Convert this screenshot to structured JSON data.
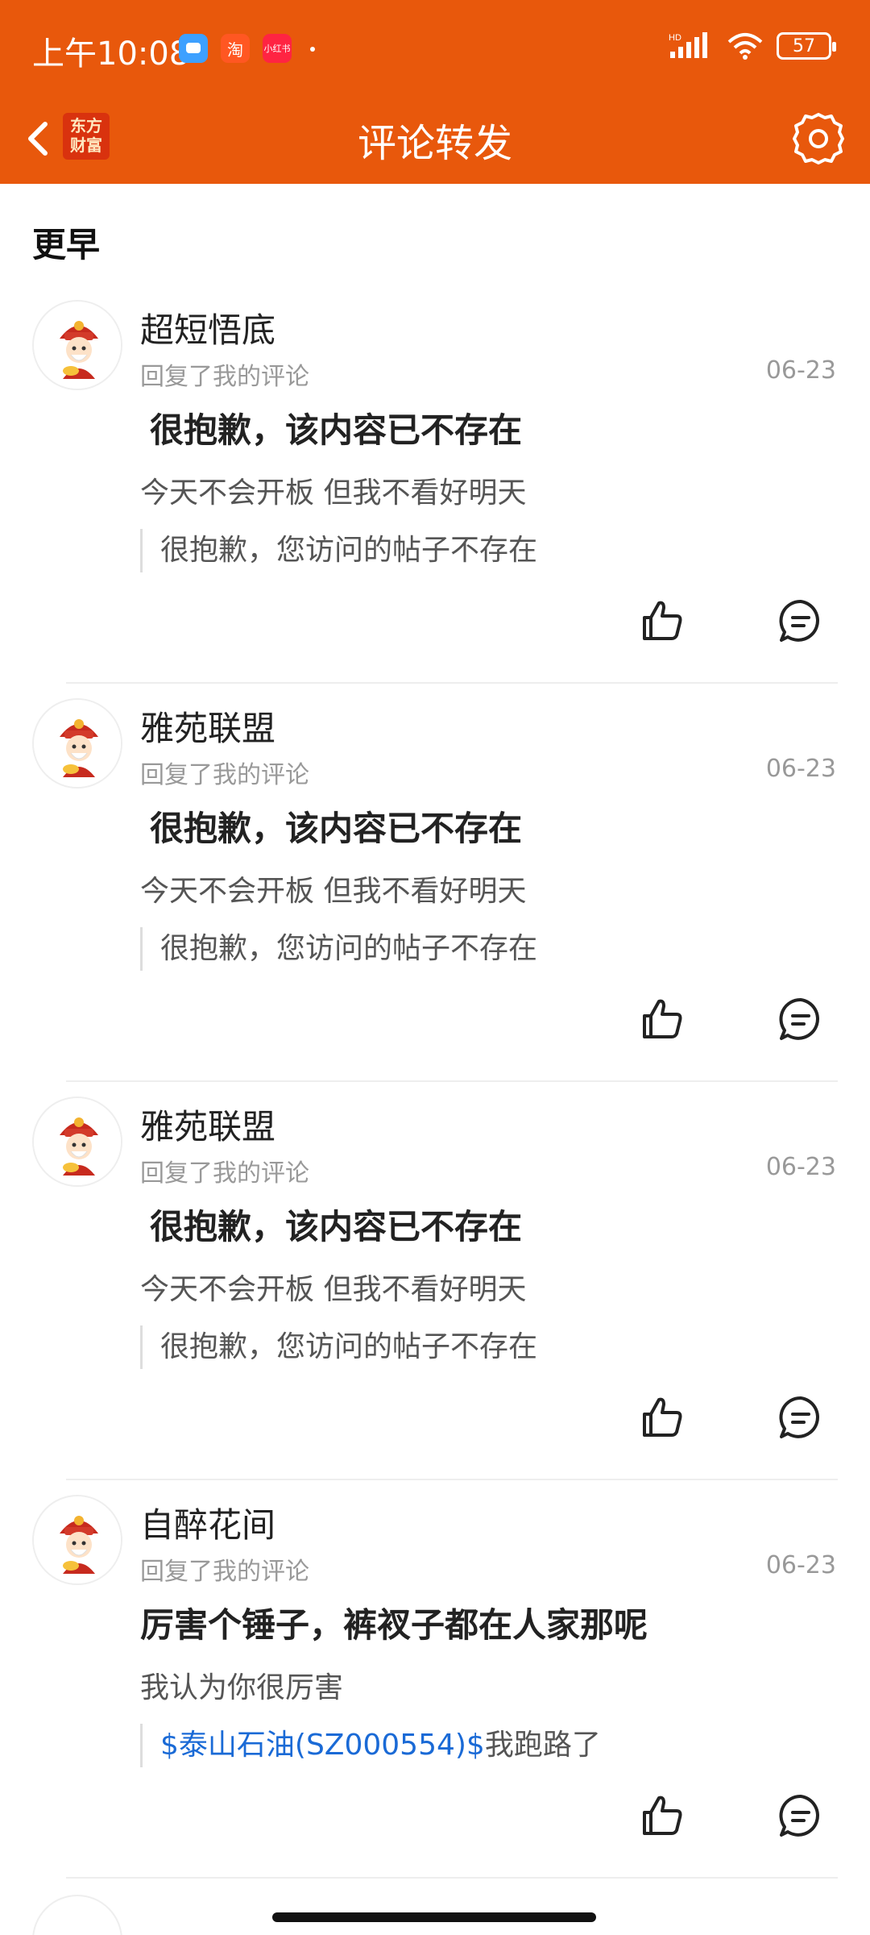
{
  "status_bar": {
    "time": "上午10:08",
    "battery": "57",
    "app_icons": [
      {
        "name": "message-app-icon",
        "color": "#3da0ff",
        "label": ""
      },
      {
        "name": "taobao-app-icon",
        "color": "#ff5722",
        "label": "淘"
      },
      {
        "name": "xiaohongshu-app-icon",
        "color": "#ff2442",
        "label": "小红书"
      }
    ]
  },
  "nav": {
    "title": "评论转发",
    "brand": "东方财富"
  },
  "section": {
    "title": "更早"
  },
  "items": [
    {
      "name": "超短悟底",
      "subtitle": "回复了我的评论",
      "date": "06-23",
      "heading": "很抱歉，该内容已不存在",
      "body": "今天不会开板 但我不看好明天",
      "quote_link": "",
      "quote_text": "很抱歉，您访问的帖子不存在"
    },
    {
      "name": "雅苑联盟",
      "subtitle": "回复了我的评论",
      "date": "06-23",
      "heading": "很抱歉，该内容已不存在",
      "body": "今天不会开板 但我不看好明天",
      "quote_link": "",
      "quote_text": "很抱歉，您访问的帖子不存在"
    },
    {
      "name": "雅苑联盟",
      "subtitle": "回复了我的评论",
      "date": "06-23",
      "heading": "很抱歉，该内容已不存在",
      "body": "今天不会开板 但我不看好明天",
      "quote_link": "",
      "quote_text": "很抱歉，您访问的帖子不存在"
    },
    {
      "name": "自醉花间",
      "subtitle": "回复了我的评论",
      "date": "06-23",
      "heading": "厉害个锤子，裤衩子都在人家那呢",
      "body": "我认为你很厉害",
      "quote_link": "$泰山石油(SZ000554)$",
      "quote_text": "我跑路了"
    }
  ],
  "colors": {
    "accent": "#e8580c",
    "link": "#1a6ad6"
  }
}
